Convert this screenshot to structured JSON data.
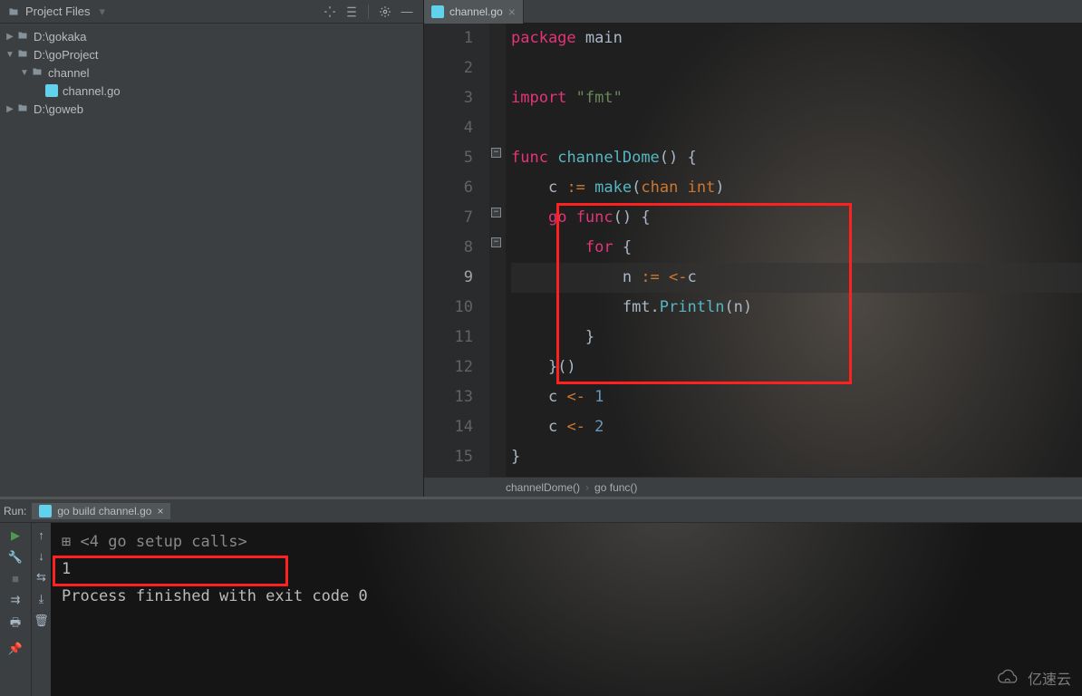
{
  "project": {
    "pane_title": "Project Files",
    "tree": [
      {
        "label": "D:\\gokaka",
        "type": "folder",
        "expanded": false,
        "indent": 0
      },
      {
        "label": "D:\\goProject",
        "type": "folder",
        "expanded": true,
        "indent": 0
      },
      {
        "label": "channel",
        "type": "folder",
        "expanded": true,
        "indent": 1
      },
      {
        "label": "channel.go",
        "type": "gofile",
        "expanded": null,
        "indent": 2
      },
      {
        "label": "D:\\goweb",
        "type": "folder",
        "expanded": false,
        "indent": 0
      }
    ]
  },
  "editor": {
    "tab_name": "channel.go",
    "current_line": 9,
    "lines": [
      {
        "n": 1,
        "tokens": [
          [
            "kw2",
            "package"
          ],
          [
            "",
            " "
          ],
          [
            "ident",
            "main"
          ]
        ]
      },
      {
        "n": 2,
        "tokens": []
      },
      {
        "n": 3,
        "tokens": [
          [
            "kw2",
            "import"
          ],
          [
            "",
            " "
          ],
          [
            "str",
            "\"fmt\""
          ]
        ]
      },
      {
        "n": 4,
        "tokens": []
      },
      {
        "n": 5,
        "tokens": [
          [
            "kw2",
            "func"
          ],
          [
            "",
            " "
          ],
          [
            "fn",
            "channelDome"
          ],
          [
            "ident",
            "() {"
          ]
        ]
      },
      {
        "n": 6,
        "tokens": [
          [
            "",
            "    "
          ],
          [
            "ident",
            "c "
          ],
          [
            "op",
            ":="
          ],
          [
            "",
            " "
          ],
          [
            "fn",
            "make"
          ],
          [
            "ident",
            "("
          ],
          [
            "kw",
            "chan"
          ],
          [
            "",
            " "
          ],
          [
            "kw",
            "int"
          ],
          [
            "ident",
            ")"
          ]
        ]
      },
      {
        "n": 7,
        "tokens": [
          [
            "",
            "    "
          ],
          [
            "kw2",
            "go"
          ],
          [
            "",
            " "
          ],
          [
            "kw2",
            "func"
          ],
          [
            "ident",
            "() {"
          ]
        ]
      },
      {
        "n": 8,
        "tokens": [
          [
            "",
            "        "
          ],
          [
            "kw2",
            "for"
          ],
          [
            "ident",
            " {"
          ]
        ]
      },
      {
        "n": 9,
        "tokens": [
          [
            "",
            "            "
          ],
          [
            "ident",
            "n "
          ],
          [
            "op",
            ":="
          ],
          [
            "",
            " "
          ],
          [
            "op",
            "<-"
          ],
          [
            "ident",
            "c"
          ]
        ]
      },
      {
        "n": 10,
        "tokens": [
          [
            "",
            "            "
          ],
          [
            "ident",
            "fmt."
          ],
          [
            "fn",
            "Println"
          ],
          [
            "ident",
            "(n)"
          ]
        ]
      },
      {
        "n": 11,
        "tokens": [
          [
            "",
            "        "
          ],
          [
            "ident",
            "}"
          ]
        ]
      },
      {
        "n": 12,
        "tokens": [
          [
            "",
            "    "
          ],
          [
            "ident",
            "}()"
          ]
        ]
      },
      {
        "n": 13,
        "tokens": [
          [
            "",
            "    "
          ],
          [
            "ident",
            "c "
          ],
          [
            "op",
            "<-"
          ],
          [
            "",
            " "
          ],
          [
            "num",
            "1"
          ]
        ]
      },
      {
        "n": 14,
        "tokens": [
          [
            "",
            "    "
          ],
          [
            "ident",
            "c "
          ],
          [
            "op",
            "<-"
          ],
          [
            "",
            " "
          ],
          [
            "num",
            "2"
          ]
        ]
      },
      {
        "n": 15,
        "tokens": [
          [
            "ident",
            "}"
          ]
        ]
      }
    ],
    "breadcrumbs": [
      "channelDome()",
      "go func()"
    ]
  },
  "run": {
    "label": "Run:",
    "tab": "go build channel.go",
    "console": [
      "<4 go setup calls>",
      "1",
      "",
      "Process finished with exit code 0"
    ]
  },
  "watermark": "亿速云"
}
